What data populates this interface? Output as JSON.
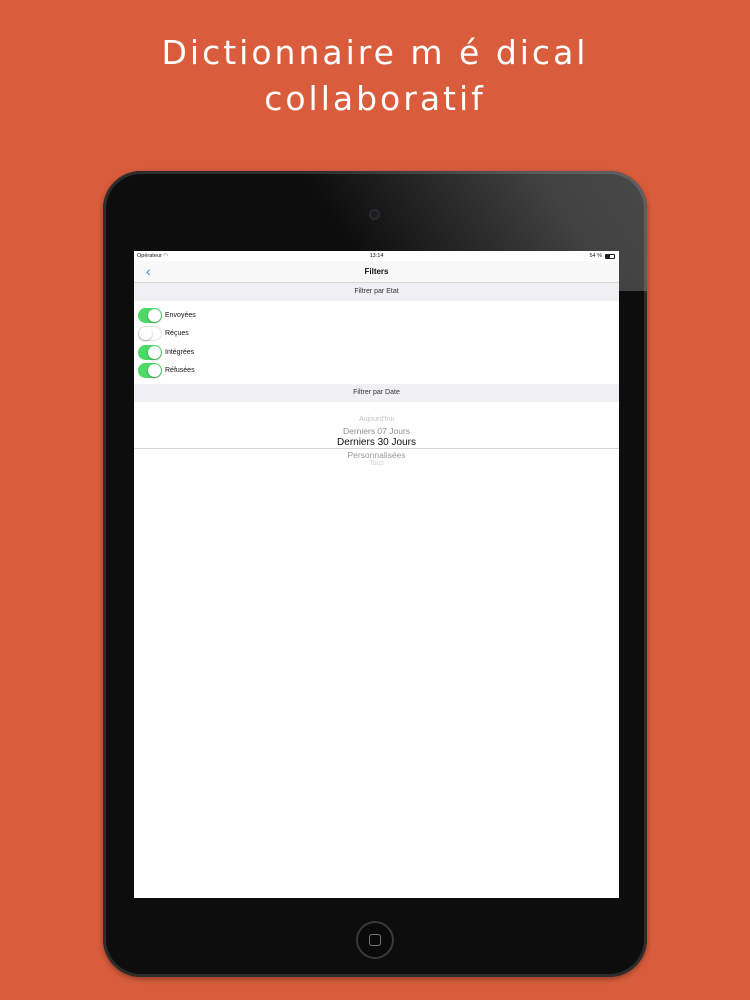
{
  "promo": {
    "headline_line1": "Dictionnaire m é dical",
    "headline_line2": "collaboratif"
  },
  "status_bar": {
    "carrier": "Opérateur",
    "time": "13:14",
    "battery": "54 %"
  },
  "navbar": {
    "back_icon": "chevron-left-icon",
    "title": "Filters"
  },
  "filter_state": {
    "header": "Filtrer par Etat",
    "items": [
      {
        "label": "Envoyées",
        "on": true
      },
      {
        "label": "Réçues",
        "on": false
      },
      {
        "label": "Intégrées",
        "on": true
      },
      {
        "label": "Réfusées",
        "on": true
      }
    ]
  },
  "filter_date": {
    "header": "Filtrer par Date",
    "options": [
      "Aujourd'hui",
      "Derniers 07 Jours",
      "Derniers 30 Jours",
      "Personnalisées",
      "Tous"
    ],
    "selected": "Derniers 30 Jours"
  },
  "colors": {
    "background": "#d95d3c",
    "toggle_on": "#4cd964",
    "accent": "#2f7cf6"
  }
}
